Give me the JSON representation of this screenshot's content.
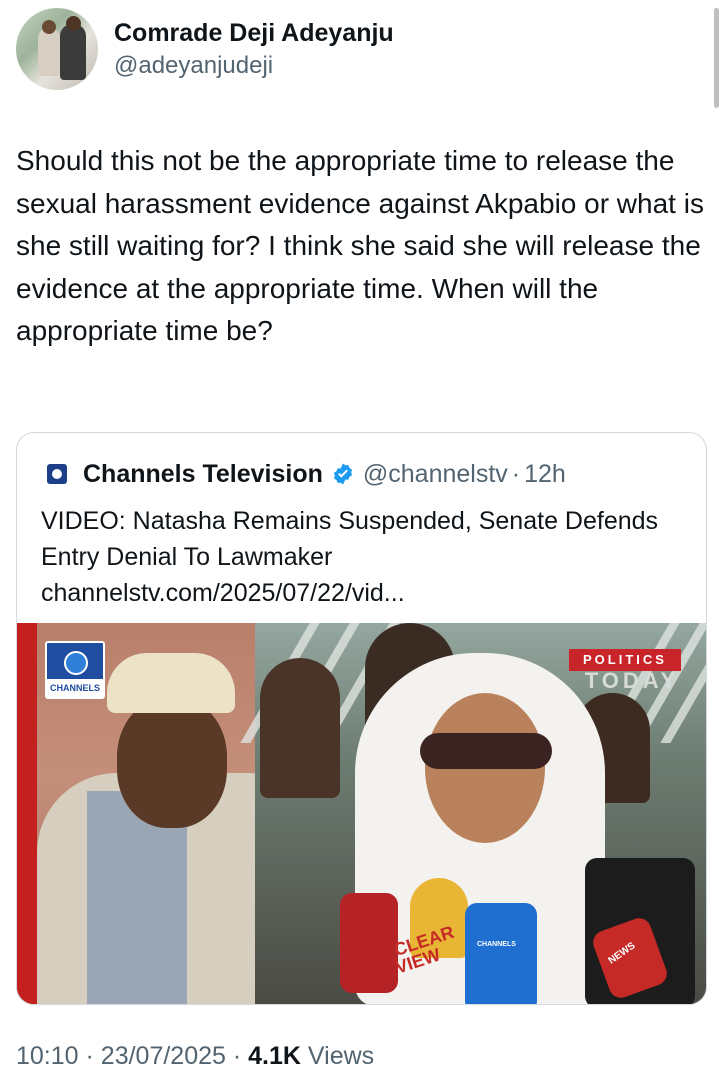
{
  "author": {
    "display_name": "Comrade Deji Adeyanju",
    "handle": "@adeyanjudeji"
  },
  "tweet": {
    "text": "Should this not be the appropriate time to release the sexual harassment evidence against Akpabio or what is she still waiting for? I think she said she will release the evidence at the appropriate time. When will the appropriate time be?"
  },
  "quoted_tweet": {
    "name": "Channels Television",
    "handle": "@channelstv",
    "separator": "·",
    "time": "12h",
    "headline": "VIDEO: Natasha Remains Suspended, Senate Defends Entry Denial To Lawmaker",
    "link": "channelstv.com/2025/07/22/vid...",
    "media": {
      "logo_label": "CHANNELS",
      "badge_top": "POLITICS",
      "badge_bottom": "TODAY",
      "mic_clear": "CLEAR",
      "mic_view": "VIEW",
      "mic_news": "NEWS",
      "mic_channels": "CHANNELS"
    }
  },
  "meta": {
    "time": "10:10",
    "separator": "·",
    "date": "23/07/2025",
    "views_count": "4.1K",
    "views_label": "Views"
  },
  "colors": {
    "verified_badge": "#1d9bf0",
    "secondary_text": "#536471",
    "primary_text": "#0f1419",
    "channels_red": "#c3201f"
  }
}
